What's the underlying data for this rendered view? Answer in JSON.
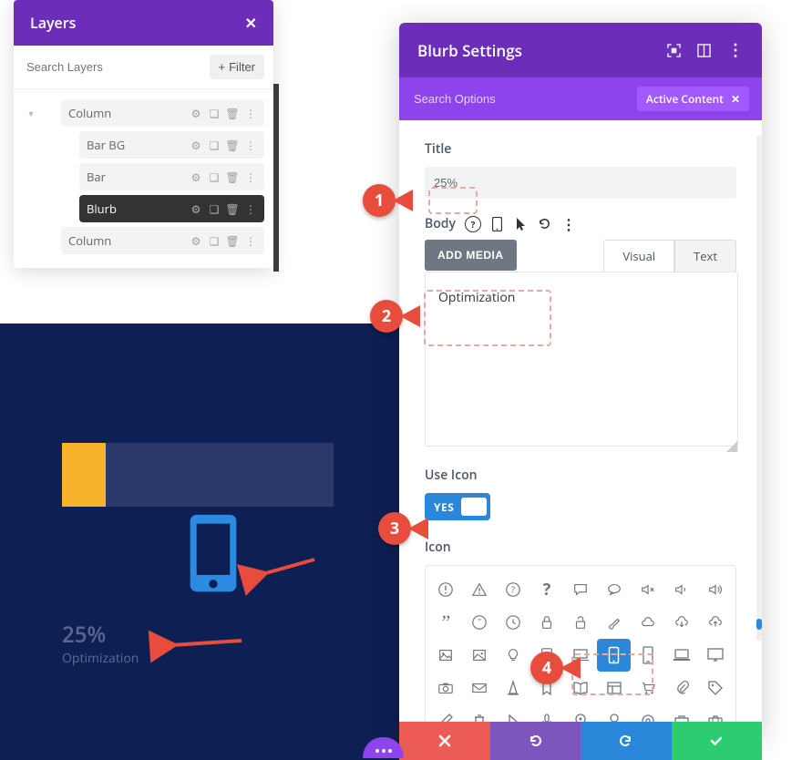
{
  "layers": {
    "title": "Layers",
    "search_placeholder": "Search Layers",
    "filter_label": "Filter",
    "items": [
      {
        "label": "Column",
        "indent": 0,
        "active": false,
        "has_arrow": true
      },
      {
        "label": "Bar BG",
        "indent": 1,
        "active": false
      },
      {
        "label": "Bar",
        "indent": 1,
        "active": false
      },
      {
        "label": "Blurb",
        "indent": 1,
        "active": true
      },
      {
        "label": "Column",
        "indent": 0,
        "active": false
      }
    ]
  },
  "preview": {
    "title_text": "25%",
    "body_text": "Optimization"
  },
  "settings": {
    "header_title": "Blurb Settings",
    "search_placeholder": "Search Options",
    "active_tag": "Active Content",
    "title_label": "Title",
    "title_value": "25%",
    "body_label": "Body",
    "add_media": "ADD MEDIA",
    "tab_visual": "Visual",
    "tab_text": "Text",
    "body_value": "Optimization",
    "use_icon_label": "Use Icon",
    "toggle_value": "YES",
    "icon_label": "Icon",
    "selected_icon": "mobile-phone",
    "icon_names_row1": [
      "exclaim-circle",
      "warning-triangle",
      "question-circle",
      "question",
      "chat",
      "chat-alt",
      "volume-mute",
      "volume-low",
      "volume-high"
    ],
    "icon_names_row2": [
      "quote",
      "quote-circle",
      "clock",
      "lock",
      "unlock",
      "brush",
      "cloud",
      "cloud-down",
      "cloud-up"
    ],
    "icon_names_row3": [
      "image",
      "image-alt",
      "bulb",
      "tablet",
      "laptop",
      "mobile-phone",
      "phone-outline",
      "laptop-alt",
      "monitor"
    ],
    "icon_names_row4": [
      "camera",
      "mail",
      "traffic-cone",
      "bookmark",
      "book",
      "layout",
      "cart",
      "paperclip",
      "tag"
    ],
    "icon_names_row5": [
      "pencil",
      "trash",
      "cursor",
      "mic",
      "pin",
      "pin-2",
      "target",
      "briefcase",
      "suitcase"
    ]
  },
  "callouts": {
    "c1": "1",
    "c2": "2",
    "c3": "3",
    "c4": "4"
  }
}
